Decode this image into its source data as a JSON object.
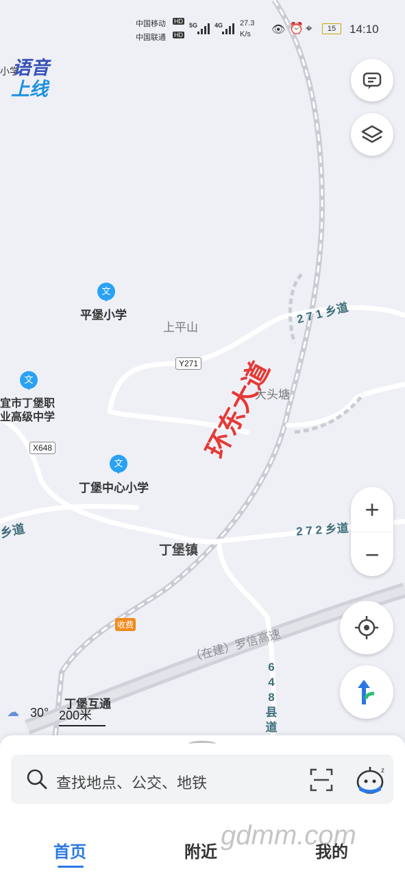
{
  "status_bar": {
    "carrier1": "中国移动",
    "carrier2": "中国联通",
    "hd": "HD",
    "net1": "5G",
    "net2": "4G",
    "speed_value": "27.3",
    "speed_unit": "K/s",
    "battery": "15",
    "time": "14:10"
  },
  "voice_badge": {
    "line1": "语音",
    "line2": "上线",
    "partial_prefix": "小学"
  },
  "map": {
    "pois": {
      "pingbao": "平堡小学",
      "dingbao_zhongxin": "丁堡中心小学",
      "vocational_line1": "宜市丁堡职",
      "vocational_line2": "业高级中学",
      "poi_glyph": "文"
    },
    "places": {
      "shangpingshan": "上平山",
      "datoutang": "大头塘",
      "dingbao_town": "丁堡镇",
      "dingbao_interchange": "丁堡互通"
    },
    "roads": {
      "y271": "Y271",
      "x648": "X648",
      "xiangdao_271": "2 7 1 乡道",
      "xiangdao_272": "2 7 2 乡道",
      "xiangdao_left": "乡道",
      "xiandao_648": "6 4 8 县道",
      "expressway": "（在建）罗信高速",
      "toll": "收费"
    },
    "annotation": "环东大道",
    "weather_temp": "30°",
    "scale": "200米"
  },
  "search": {
    "placeholder": "查找地点、公交、地铁"
  },
  "tabs": {
    "home": "首页",
    "nearby": "附近",
    "mine": "我的"
  },
  "watermark": "gdmm.com",
  "colors": {
    "accent": "#2a78e4",
    "poi": "#2aa2f3",
    "annotation": "#e53935",
    "road_label": "#3f6e7a"
  }
}
